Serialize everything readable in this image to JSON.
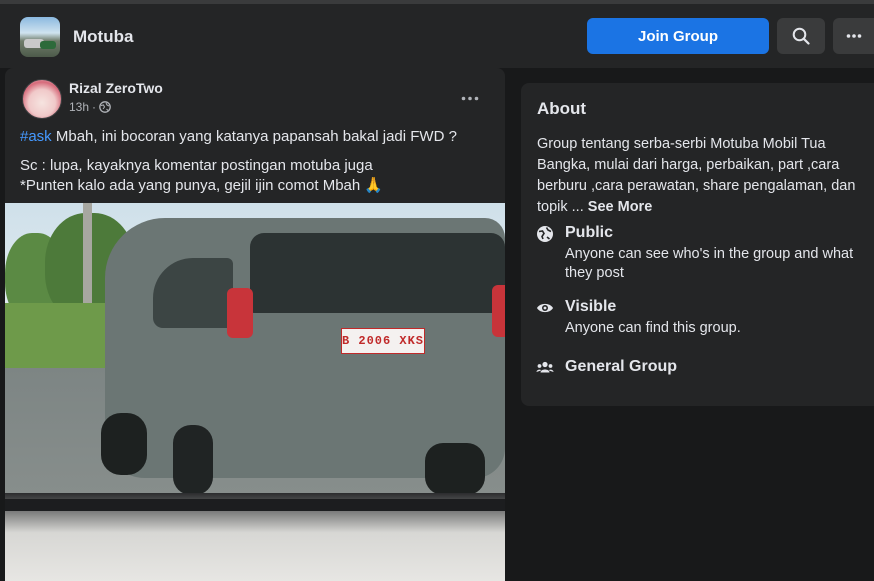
{
  "header": {
    "group_name": "Motuba",
    "join_label": "Join Group",
    "accent_color": "#1b74e4"
  },
  "post": {
    "author": "Rizal ZeroTwo",
    "time": "13h",
    "privacy_icon": "globe-icon",
    "hashtag": "#ask",
    "line1": " Mbah, ini bocoran yang katanya papansah bakal jadi FWD ?",
    "line2": "Sc : lupa, kayaknya komentar postingan motuba juga",
    "line3": "*Punten kalo ada yang punya, gejil ijin comot Mbah 🙏",
    "photo_plate": "B 2006 XKS"
  },
  "about": {
    "title": "About",
    "description": "Group tentang serba-serbi Motuba Mobil Tua Bangka, mulai dari harga, perbaikan, part ,cara berburu ,cara perawatan, share pengalaman, dan topik ...",
    "see_more": "See More",
    "items": [
      {
        "icon": "globe-icon",
        "label": "Public",
        "sub": "Anyone can see who's in the group and what they post"
      },
      {
        "icon": "eye-icon",
        "label": "Visible",
        "sub": "Anyone can find this group."
      },
      {
        "icon": "people-icon",
        "label": "General Group",
        "sub": ""
      }
    ]
  }
}
